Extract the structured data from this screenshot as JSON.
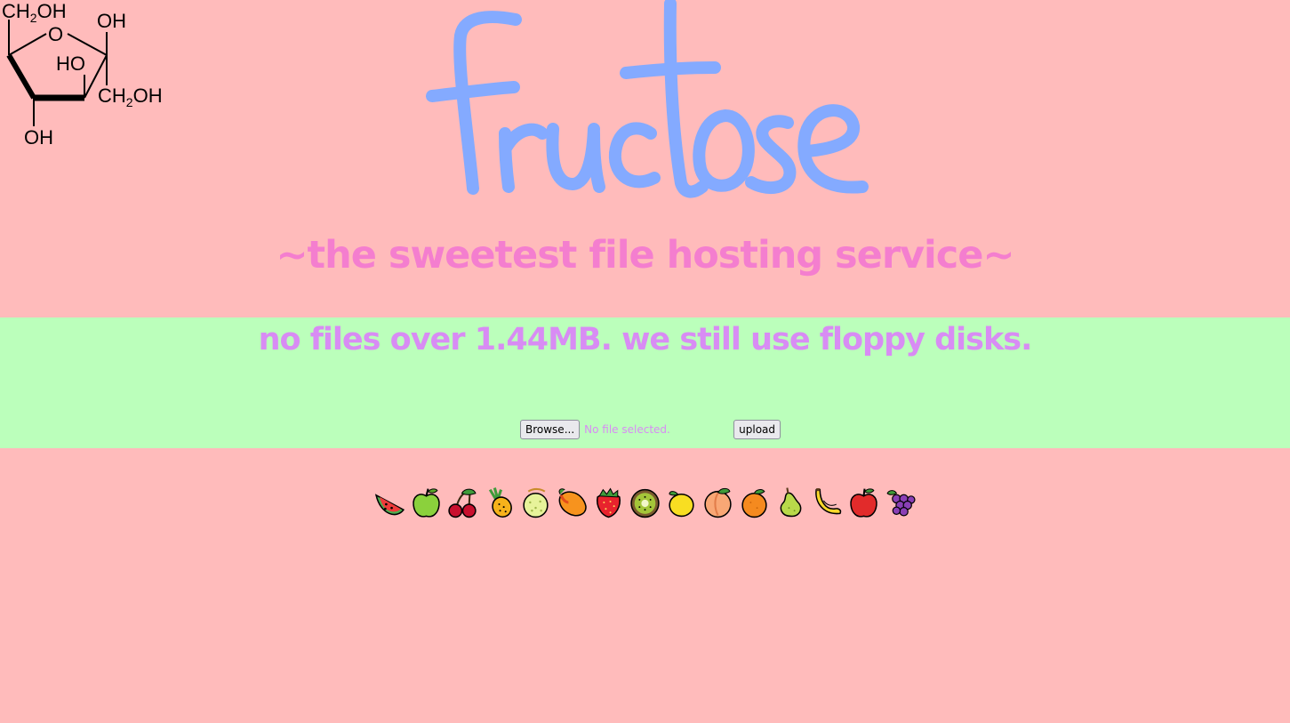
{
  "molecule": {
    "labels": {
      "ch2oh_top_a": "CH",
      "ch2oh_top_sub": "2",
      "ch2oh_top_b": "OH",
      "oh_top_right": "OH",
      "ring_o": "O",
      "ho_inner": "HO",
      "ch2oh_right_a": "CH",
      "ch2oh_right_sub": "2",
      "ch2oh_right_b": "OH",
      "oh_bottom": "OH"
    }
  },
  "logo": {
    "text": "fructose",
    "color": "#84aaff"
  },
  "tagline": "~the sweetest file hosting service~",
  "notice": "no files over 1.44MB. we still use floppy disks.",
  "upload": {
    "browse_label": "Browse...",
    "file_status": "No file selected.",
    "submit_label": "upload"
  },
  "fruits": [
    {
      "name": "watermelon-icon"
    },
    {
      "name": "green-apple-icon"
    },
    {
      "name": "cherries-icon"
    },
    {
      "name": "pineapple-icon"
    },
    {
      "name": "melon-icon"
    },
    {
      "name": "mango-icon"
    },
    {
      "name": "strawberry-icon"
    },
    {
      "name": "kiwi-icon"
    },
    {
      "name": "lemon-icon"
    },
    {
      "name": "peach-icon"
    },
    {
      "name": "tangerine-icon"
    },
    {
      "name": "pear-icon"
    },
    {
      "name": "banana-icon"
    },
    {
      "name": "red-apple-icon"
    },
    {
      "name": "grapes-icon"
    }
  ],
  "colors": {
    "page_bg": "#ffbbbb",
    "band_bg": "#bbffbb",
    "tagline": "#f47ecf",
    "notice": "#d88cf4",
    "logo": "#84aaff"
  }
}
